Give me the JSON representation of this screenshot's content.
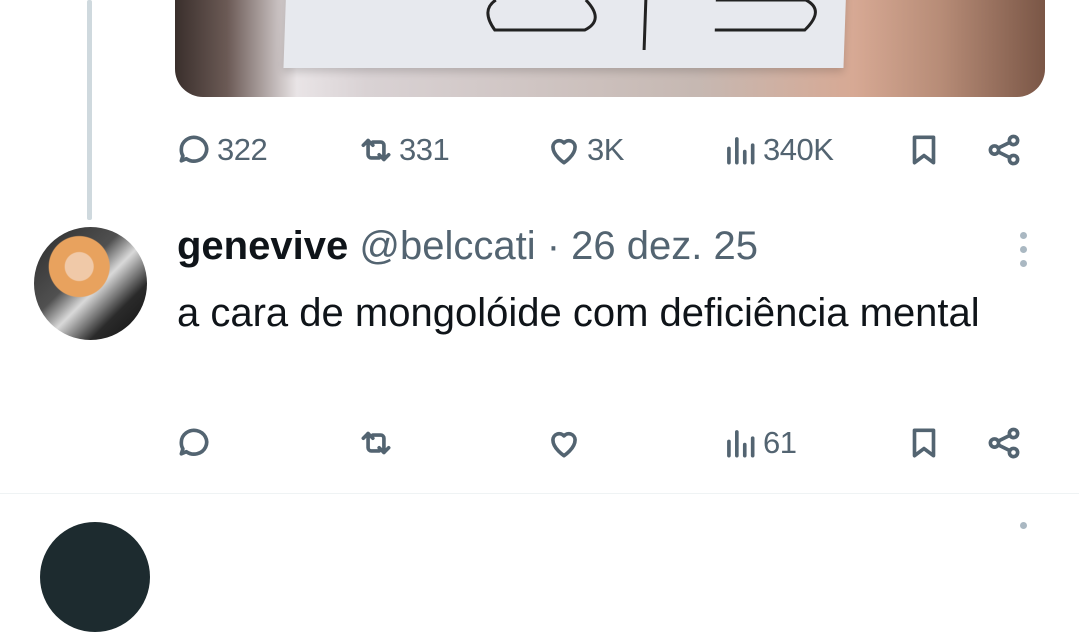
{
  "prev_tweet": {
    "stats": {
      "replies": "322",
      "retweets": "331",
      "likes": "3K",
      "views": "340K"
    }
  },
  "reply": {
    "display_name": "genevive",
    "handle": "@belccati",
    "separator": "·",
    "date": "26 dez. 25",
    "text": "a cara de mongolóide com deficiência mental",
    "stats": {
      "replies": "",
      "retweets": "",
      "likes": "",
      "views": "61"
    }
  },
  "icons": [
    "reply-icon",
    "retweet-icon",
    "like-icon",
    "views-icon",
    "bookmark-icon",
    "share-icon",
    "more-icon"
  ]
}
